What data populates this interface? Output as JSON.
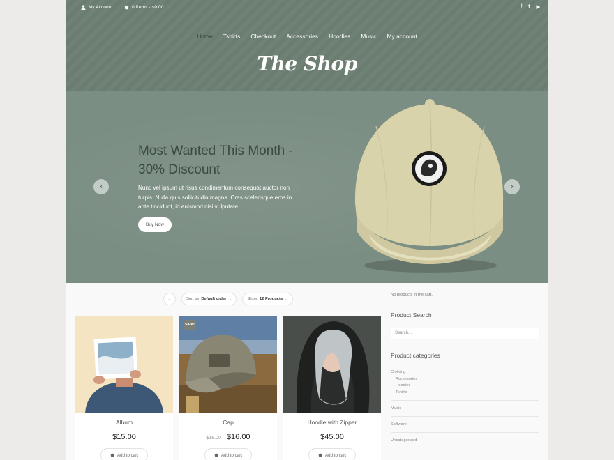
{
  "topbar": {
    "account_label": "My Account",
    "cart_label": "0 items - $0.00"
  },
  "social": {
    "facebook": "f",
    "twitter": "t",
    "youtube": "▶"
  },
  "nav": {
    "items": [
      "Home",
      "Tshirts",
      "Checkout",
      "Accessories",
      "Hoodies",
      "Music",
      "My account"
    ],
    "active": "Home"
  },
  "site": {
    "title": "The Shop"
  },
  "hero": {
    "title": "Most Wanted This Month - 30% Discount",
    "text": "Nunc vel ipsum ut risus condimentum consequat auctor non turpis. Nulla quis sollicitudin magna. Cras scelerisque eros in ante tincidunt, id euismod nisi vulputate.",
    "button": "Buy Now"
  },
  "shop": {
    "sort_prefix": "Sort by",
    "sort_value": "Default order",
    "show_prefix": "Show",
    "show_value": "12 Products",
    "products": [
      {
        "name": "Album",
        "price": "$15.00",
        "old_price": "",
        "cart": "Add to cart"
      },
      {
        "name": "Cap",
        "price": "$16.00",
        "old_price": "$18.00",
        "cart": "Add to cart",
        "badge": "Sale!"
      },
      {
        "name": "Hoodie with Zipper",
        "price": "$45.00",
        "old_price": "",
        "cart": "Add to cart"
      }
    ]
  },
  "sidebar": {
    "cart_empty": "No products in the cart.",
    "search_title": "Product Search",
    "search_placeholder": "Search...",
    "categories_title": "Product categories",
    "categories": [
      "Clothing",
      "Accessories",
      "Hoodies",
      "Tshirts",
      "Music",
      "Software",
      "Uncategorized"
    ]
  },
  "colors": {
    "header": "#6c7f72",
    "hero": "#7b8e83",
    "hero_title": "#3b4a42",
    "page": "#f9f9f9"
  }
}
